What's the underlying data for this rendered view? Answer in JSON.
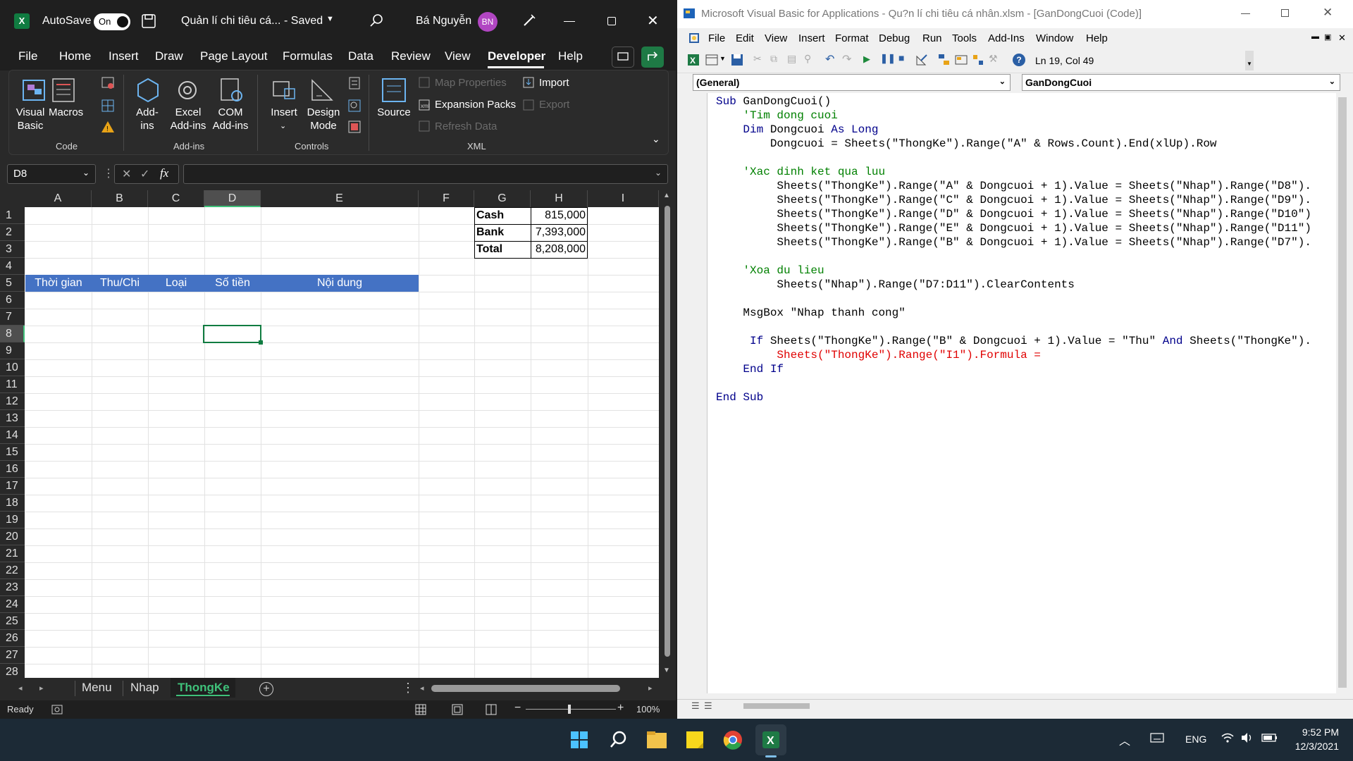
{
  "excel": {
    "title": {
      "autosave": "AutoSave",
      "toggle": "On",
      "filename": "Quản lí chi tiêu cá...",
      "saved": "- Saved",
      "user": "Bá Nguyễn",
      "initials": "BN"
    },
    "menu": [
      "File",
      "Home",
      "Insert",
      "Draw",
      "Page Layout",
      "Formulas",
      "Data",
      "Review",
      "View",
      "Developer",
      "Help"
    ],
    "ribbon": {
      "code": {
        "visual_basic": "Visual\nBasic",
        "macros": "Macros",
        "group": "Code"
      },
      "addins": {
        "addins": "Add-\nins",
        "excel_addins": "Excel\nAdd-ins",
        "com_addins": "COM\nAdd-ins",
        "group": "Add-ins"
      },
      "controls": {
        "insert": "Insert",
        "design_mode": "Design\nMode",
        "group": "Controls"
      },
      "xml": {
        "source": "Source",
        "map_properties": "Map Properties",
        "expansion_packs": "Expansion Packs",
        "refresh_data": "Refresh Data",
        "import": "Import",
        "export": "Export",
        "group": "XML"
      }
    },
    "namebox": "D8",
    "columns": [
      "A",
      "B",
      "C",
      "D",
      "E",
      "F",
      "G",
      "H",
      "I"
    ],
    "rows": [
      "1",
      "2",
      "3",
      "4",
      "5",
      "6",
      "7",
      "8",
      "9",
      "10",
      "11",
      "12",
      "13",
      "14",
      "15",
      "16",
      "17",
      "18",
      "19",
      "20",
      "21",
      "22",
      "23",
      "24",
      "25",
      "26",
      "27",
      "28"
    ],
    "summary": [
      {
        "label": "Cash",
        "value": "815,000"
      },
      {
        "label": "Bank",
        "value": "7,393,000"
      },
      {
        "label": "Total",
        "value": "8,208,000"
      }
    ],
    "headers": [
      "Thời gian",
      "Thu/Chi",
      "Loại",
      "Số tiền",
      "Nội dung"
    ],
    "sheets": [
      "Menu",
      "Nhap",
      "ThongKe"
    ],
    "status": {
      "ready": "Ready",
      "zoom": "100%"
    }
  },
  "vba": {
    "title": "Microsoft Visual Basic for Applications - Qu?n lí chi tiêu cá nhân.xlsm - [GanDongCuoi (Code)]",
    "menu": [
      "File",
      "Edit",
      "View",
      "Insert",
      "Format",
      "Debug",
      "Run",
      "Tools",
      "Add-Ins",
      "Window",
      "Help"
    ],
    "position": "Ln 19, Col 49",
    "object_combo": "(General)",
    "proc_combo": "GanDongCuoi",
    "code": {
      "l1a": "Sub",
      " l1b": " GanDongCuoi()",
      "l2": "    'Tim dong cuoi",
      "l3a": "    Dim",
      "l3b": " Dongcuoi ",
      "l3c": "As Long",
      "l4": "        Dongcuoi = Sheets(\"ThongKe\").Range(\"A\" & Rows.Count).End(xlUp).Row",
      "l6": "    'Xac dinh ket qua luu",
      "l7": "         Sheets(\"ThongKe\").Range(\"A\" & Dongcuoi + 1).Value = Sheets(\"Nhap\").Range(\"D8\").",
      "l8": "         Sheets(\"ThongKe\").Range(\"C\" & Dongcuoi + 1).Value = Sheets(\"Nhap\").Range(\"D9\").",
      "l9": "         Sheets(\"ThongKe\").Range(\"D\" & Dongcuoi + 1).Value = Sheets(\"Nhap\").Range(\"D10\")",
      "l10": "         Sheets(\"ThongKe\").Range(\"E\" & Dongcuoi + 1).Value = Sheets(\"Nhap\").Range(\"D11\")",
      "l11": "         Sheets(\"ThongKe\").Range(\"B\" & Dongcuoi + 1).Value = Sheets(\"Nhap\").Range(\"D7\").",
      "l13": "    'Xoa du lieu",
      "l14": "         Sheets(\"Nhap\").Range(\"D7:D11\").ClearContents",
      "l16": "    MsgBox \"Nhap thanh cong\"",
      "l18a": "     If",
      "l18b": " Sheets(\"ThongKe\").Range(\"B\" & Dongcuoi + 1).Value = \"Thu\" ",
      "l18c": "And",
      "l18d": " Sheets(\"ThongKe\").",
      "l19": "         Sheets(\"ThongKe\").Range(\"I1\").Formula =",
      "l20": "    End If",
      "l22": "End Sub"
    }
  },
  "taskbar": {
    "lang": "ENG",
    "time": "9:52 PM",
    "date": "12/3/2021"
  }
}
